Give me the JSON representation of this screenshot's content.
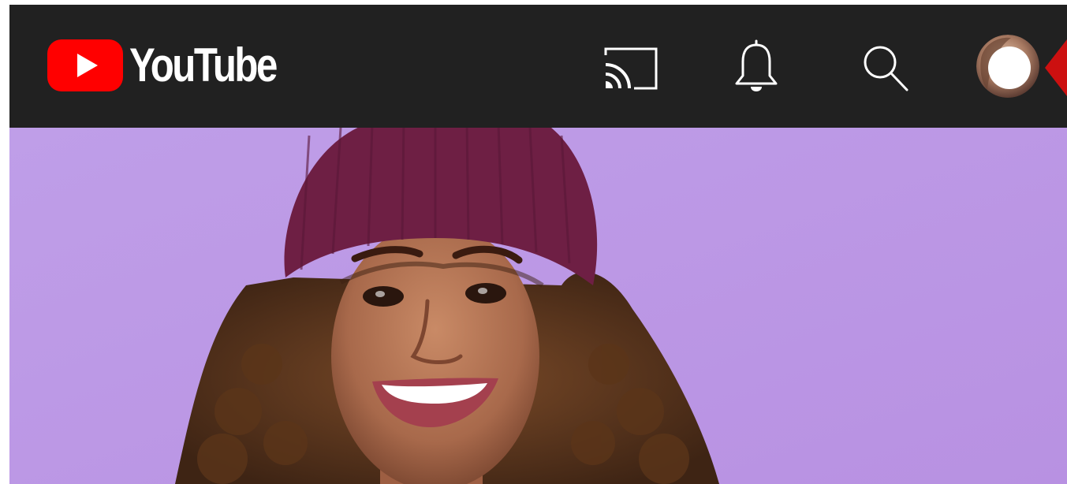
{
  "app": {
    "name": "YouTube",
    "logo_text": "YouTube"
  },
  "topbar": {
    "background_color": "#212121",
    "icons": [
      "youtube-logo-icon",
      "cast-icon",
      "bell-icon",
      "search-icon",
      "avatar"
    ]
  },
  "colors": {
    "brand_red": "#ff0000",
    "hero_background": "#c09ce8",
    "icon_white": "#ffffff",
    "beanie": "#6e1f44"
  },
  "hero": {
    "type": "video-thumbnail"
  }
}
